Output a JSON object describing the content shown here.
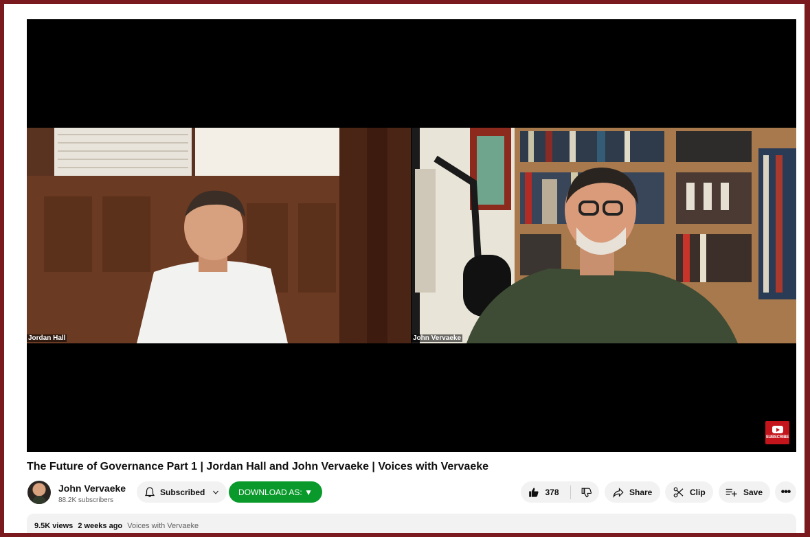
{
  "player": {
    "left_label": "Jordan Hall",
    "right_label": "John Vervaeke",
    "watermark_label": "SUBSCRIBE"
  },
  "video": {
    "title": "The Future of Governance Part 1 | Jordan Hall and John Vervaeke | Voices with Vervaeke"
  },
  "channel": {
    "name": "John Vervaeke",
    "subscribers": "88.2K subscribers"
  },
  "actions": {
    "subscribed_label": "Subscribed",
    "download_label": "DOWNLOAD AS: ▼",
    "like_count": "378",
    "share_label": "Share",
    "clip_label": "Clip",
    "save_label": "Save",
    "more_label": "•••"
  },
  "description": {
    "views": "9.5K views",
    "date": "2 weeks ago",
    "tag": "Voices with Vervaeke"
  },
  "colors": {
    "frame": "#7a1a1f",
    "download": "#0a9a2c",
    "watermark": "#c4151c"
  }
}
